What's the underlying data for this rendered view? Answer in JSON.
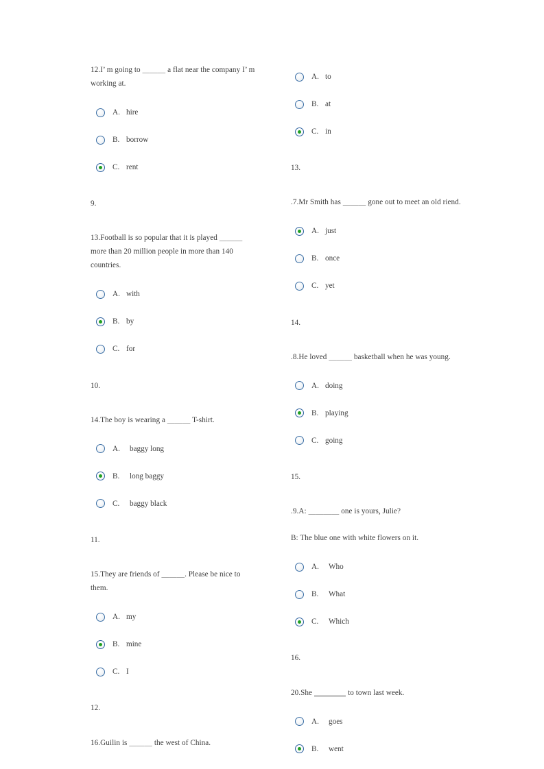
{
  "page": {
    "background": "#ffffff",
    "text_color": "#3d3d3d",
    "radio_border_color": "#3a6ea5",
    "radio_dot_color": "#21a021"
  },
  "left_column": {
    "q12": {
      "text": "12.I’ m going to ＿＿＿ a flat near the company I’ m working at.",
      "options": [
        {
          "letter": "A.",
          "label": "hire",
          "checked": false
        },
        {
          "letter": "B.",
          "label": "borrow",
          "checked": false
        },
        {
          "letter": "C.",
          "label": "rent",
          "checked": true
        }
      ]
    },
    "marker_9": "9.",
    "q13": {
      "text": "13.Football is so popular that it is played ＿＿＿ more than 20 million people in more than 140 countries.",
      "options": [
        {
          "letter": "A.",
          "label": "with",
          "checked": false
        },
        {
          "letter": "B.",
          "label": "by",
          "checked": true
        },
        {
          "letter": "C.",
          "label": "for",
          "checked": false
        }
      ]
    },
    "marker_10": "10.",
    "q14": {
      "text": "14.The boy is wearing a ＿＿＿ T-shirt.",
      "options": [
        {
          "letter": "A.",
          "label": "baggy long",
          "checked": false
        },
        {
          "letter": "B.",
          "label": "long baggy",
          "checked": true
        },
        {
          "letter": "C.",
          "label": "baggy black",
          "checked": false
        }
      ]
    },
    "marker_11": "11.",
    "q15": {
      "text": "15.They are friends of ＿＿＿. Please be nice to them.",
      "options": [
        {
          "letter": "A.",
          "label": "my",
          "checked": false
        },
        {
          "letter": "B.",
          "label": "mine",
          "checked": true
        },
        {
          "letter": "C.",
          "label": "I",
          "checked": false
        }
      ]
    },
    "marker_12": "12.",
    "q16": {
      "text": "16.Guilin is ＿＿＿ the west of China."
    }
  },
  "right_column": {
    "q_top_options": [
      {
        "letter": "A.",
        "label": "to",
        "checked": false
      },
      {
        "letter": "B.",
        "label": "at",
        "checked": false
      },
      {
        "letter": "C.",
        "label": "in",
        "checked": true
      }
    ],
    "marker_13": "13.",
    "q17": {
      "text": ".7.Mr Smith has ＿＿＿ gone out to meet an old riend.",
      "options": [
        {
          "letter": "A.",
          "label": "just",
          "checked": true
        },
        {
          "letter": "B.",
          "label": "once",
          "checked": false
        },
        {
          "letter": "C.",
          "label": "yet",
          "checked": false
        }
      ]
    },
    "marker_14": "14.",
    "q18": {
      "text": ".8.He loved ＿＿＿ basketball when he was young.",
      "options": [
        {
          "letter": "A.",
          "label": "doing",
          "checked": false
        },
        {
          "letter": "B.",
          "label": "playing",
          "checked": true
        },
        {
          "letter": "C.",
          "label": "going",
          "checked": false
        }
      ]
    },
    "marker_15": "15.",
    "q19": {
      "line_a": ".9.A: ＿＿＿＿ one is yours, Julie?",
      "line_b": "B: The blue one with white flowers on it.",
      "options": [
        {
          "letter": "A.",
          "label": "Who",
          "checked": false
        },
        {
          "letter": "B.",
          "label": "What",
          "checked": false
        },
        {
          "letter": "C.",
          "label": "Which",
          "checked": true
        }
      ]
    },
    "marker_16": "16.",
    "q20": {
      "text_before": "20.She",
      "text_after": "to town last week.",
      "options": [
        {
          "letter": "A.",
          "label": "goes",
          "checked": false
        },
        {
          "letter": "B.",
          "label": "went",
          "checked": true
        }
      ]
    }
  }
}
